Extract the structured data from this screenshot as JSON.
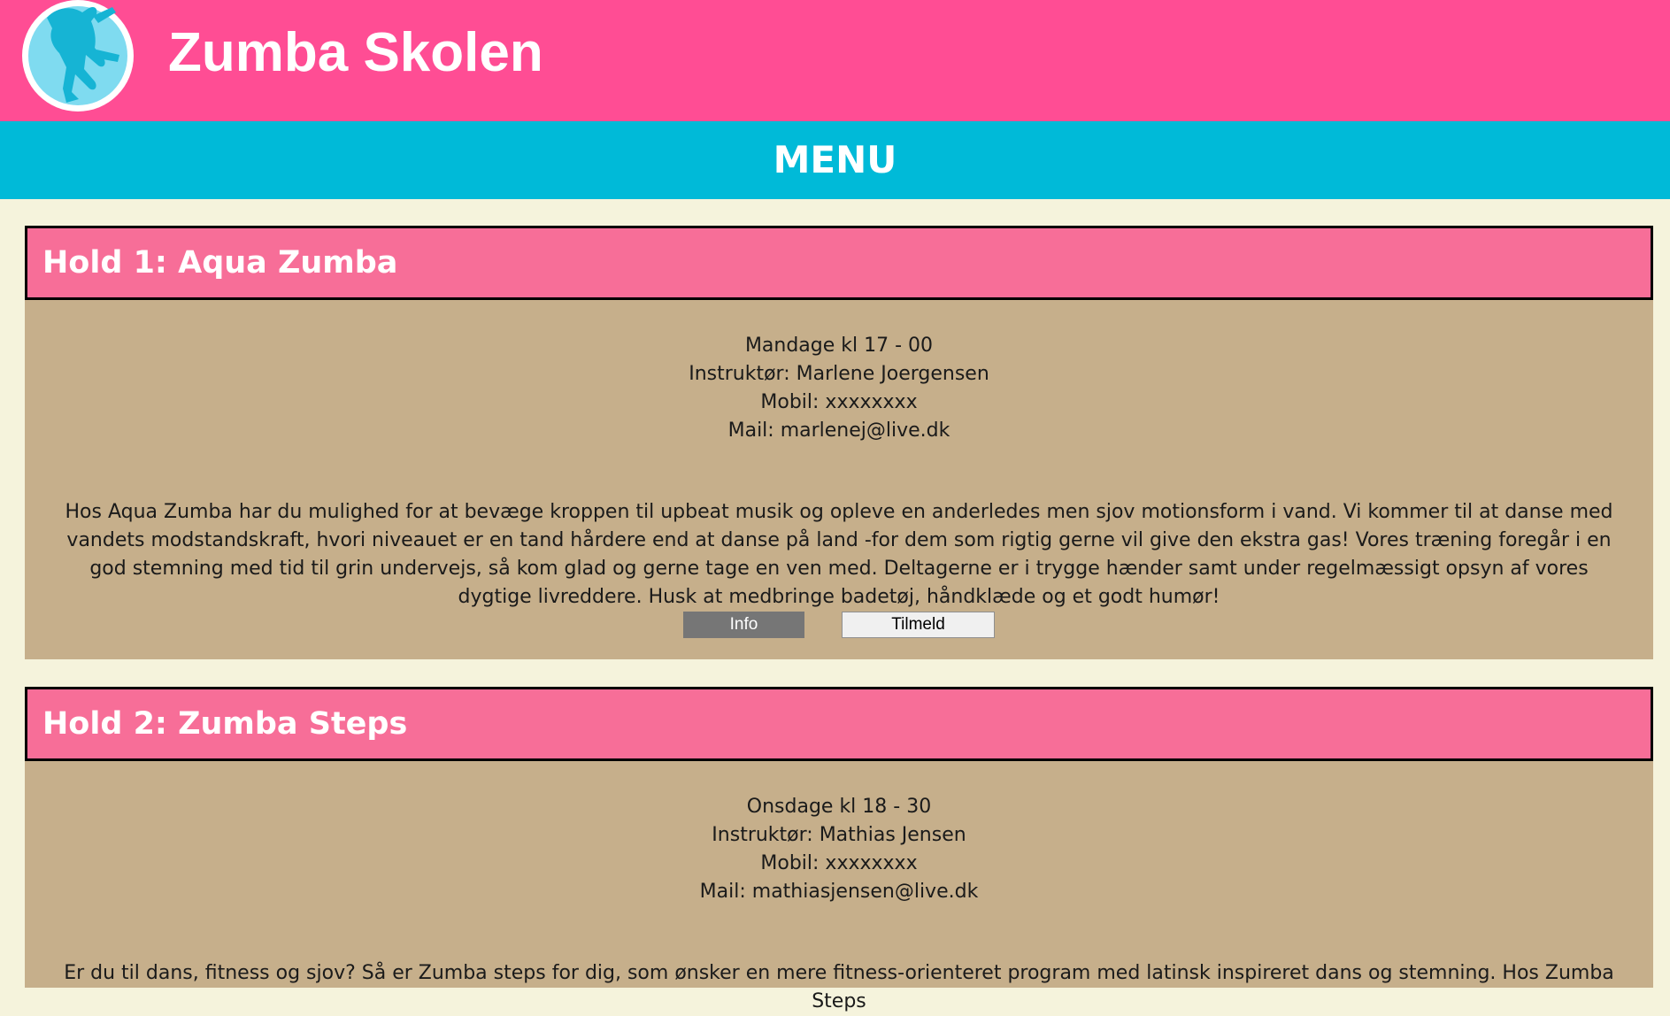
{
  "header": {
    "title": "Zumba Skolen",
    "background_color": "#ff4d94",
    "logo_icon": "dancer-logo-icon"
  },
  "menu": {
    "label": "MENU",
    "background_color": "#00bad8"
  },
  "holds": [
    {
      "title": "Hold 1: Aqua Zumba",
      "schedule": "Mandage kl 17 - 00",
      "instructor": "Instruktør: Marlene Joergensen",
      "mobile": "Mobil: xxxxxxxx",
      "mail": "Mail: marlenej@live.dk",
      "description": "Hos Aqua Zumba har du mulighed for at bevæge kroppen til upbeat musik og opleve en anderledes men sjov motionsform i vand. Vi kommer til at danse med vandets modstandskraft, hvori niveauet er en tand hårdere end at danse på land -for dem som rigtig gerne vil give den ekstra gas! Vores træning foregår i en god stemning med tid til grin undervejs, så kom glad og gerne tage en ven med. Deltagerne er i trygge hænder samt under regelmæssigt opsyn af vores dygtige livreddere. Husk at medbringe badetøj, håndklæde og et godt humør!",
      "info_button": "Info",
      "signup_button": "Tilmeld"
    },
    {
      "title": "Hold 2: Zumba Steps",
      "schedule": "Onsdage kl 18 - 30",
      "instructor": "Instruktør: Mathias Jensen",
      "mobile": "Mobil: xxxxxxxx",
      "mail": "Mail: mathiasjensen@live.dk",
      "description": "Er du til dans, fitness og sjov? Så er Zumba steps for dig, som ønsker en mere fitness-orienteret program med latinsk inspireret dans og stemning. Hos Zumba Steps"
    }
  ],
  "colors": {
    "page_background": "#f5f3dc",
    "card_background": "#c6af8b",
    "card_title_background": "#f76e98",
    "button_info": "#767676"
  }
}
